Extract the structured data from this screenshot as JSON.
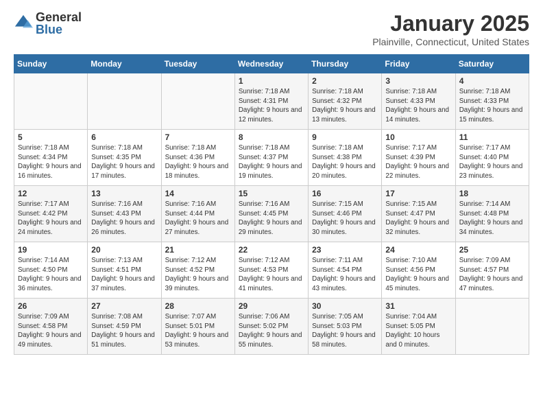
{
  "logo": {
    "line1": "General",
    "line2": "Blue"
  },
  "title": "January 2025",
  "subtitle": "Plainville, Connecticut, United States",
  "days_of_week": [
    "Sunday",
    "Monday",
    "Tuesday",
    "Wednesday",
    "Thursday",
    "Friday",
    "Saturday"
  ],
  "weeks": [
    [
      {
        "day": "",
        "info": ""
      },
      {
        "day": "",
        "info": ""
      },
      {
        "day": "",
        "info": ""
      },
      {
        "day": "1",
        "info": "Sunrise: 7:18 AM\nSunset: 4:31 PM\nDaylight: 9 hours\nand 12 minutes."
      },
      {
        "day": "2",
        "info": "Sunrise: 7:18 AM\nSunset: 4:32 PM\nDaylight: 9 hours\nand 13 minutes."
      },
      {
        "day": "3",
        "info": "Sunrise: 7:18 AM\nSunset: 4:33 PM\nDaylight: 9 hours\nand 14 minutes."
      },
      {
        "day": "4",
        "info": "Sunrise: 7:18 AM\nSunset: 4:33 PM\nDaylight: 9 hours\nand 15 minutes."
      }
    ],
    [
      {
        "day": "5",
        "info": "Sunrise: 7:18 AM\nSunset: 4:34 PM\nDaylight: 9 hours\nand 16 minutes."
      },
      {
        "day": "6",
        "info": "Sunrise: 7:18 AM\nSunset: 4:35 PM\nDaylight: 9 hours\nand 17 minutes."
      },
      {
        "day": "7",
        "info": "Sunrise: 7:18 AM\nSunset: 4:36 PM\nDaylight: 9 hours\nand 18 minutes."
      },
      {
        "day": "8",
        "info": "Sunrise: 7:18 AM\nSunset: 4:37 PM\nDaylight: 9 hours\nand 19 minutes."
      },
      {
        "day": "9",
        "info": "Sunrise: 7:18 AM\nSunset: 4:38 PM\nDaylight: 9 hours\nand 20 minutes."
      },
      {
        "day": "10",
        "info": "Sunrise: 7:17 AM\nSunset: 4:39 PM\nDaylight: 9 hours\nand 22 minutes."
      },
      {
        "day": "11",
        "info": "Sunrise: 7:17 AM\nSunset: 4:40 PM\nDaylight: 9 hours\nand 23 minutes."
      }
    ],
    [
      {
        "day": "12",
        "info": "Sunrise: 7:17 AM\nSunset: 4:42 PM\nDaylight: 9 hours\nand 24 minutes."
      },
      {
        "day": "13",
        "info": "Sunrise: 7:16 AM\nSunset: 4:43 PM\nDaylight: 9 hours\nand 26 minutes."
      },
      {
        "day": "14",
        "info": "Sunrise: 7:16 AM\nSunset: 4:44 PM\nDaylight: 9 hours\nand 27 minutes."
      },
      {
        "day": "15",
        "info": "Sunrise: 7:16 AM\nSunset: 4:45 PM\nDaylight: 9 hours\nand 29 minutes."
      },
      {
        "day": "16",
        "info": "Sunrise: 7:15 AM\nSunset: 4:46 PM\nDaylight: 9 hours\nand 30 minutes."
      },
      {
        "day": "17",
        "info": "Sunrise: 7:15 AM\nSunset: 4:47 PM\nDaylight: 9 hours\nand 32 minutes."
      },
      {
        "day": "18",
        "info": "Sunrise: 7:14 AM\nSunset: 4:48 PM\nDaylight: 9 hours\nand 34 minutes."
      }
    ],
    [
      {
        "day": "19",
        "info": "Sunrise: 7:14 AM\nSunset: 4:50 PM\nDaylight: 9 hours\nand 36 minutes."
      },
      {
        "day": "20",
        "info": "Sunrise: 7:13 AM\nSunset: 4:51 PM\nDaylight: 9 hours\nand 37 minutes."
      },
      {
        "day": "21",
        "info": "Sunrise: 7:12 AM\nSunset: 4:52 PM\nDaylight: 9 hours\nand 39 minutes."
      },
      {
        "day": "22",
        "info": "Sunrise: 7:12 AM\nSunset: 4:53 PM\nDaylight: 9 hours\nand 41 minutes."
      },
      {
        "day": "23",
        "info": "Sunrise: 7:11 AM\nSunset: 4:54 PM\nDaylight: 9 hours\nand 43 minutes."
      },
      {
        "day": "24",
        "info": "Sunrise: 7:10 AM\nSunset: 4:56 PM\nDaylight: 9 hours\nand 45 minutes."
      },
      {
        "day": "25",
        "info": "Sunrise: 7:09 AM\nSunset: 4:57 PM\nDaylight: 9 hours\nand 47 minutes."
      }
    ],
    [
      {
        "day": "26",
        "info": "Sunrise: 7:09 AM\nSunset: 4:58 PM\nDaylight: 9 hours\nand 49 minutes."
      },
      {
        "day": "27",
        "info": "Sunrise: 7:08 AM\nSunset: 4:59 PM\nDaylight: 9 hours\nand 51 minutes."
      },
      {
        "day": "28",
        "info": "Sunrise: 7:07 AM\nSunset: 5:01 PM\nDaylight: 9 hours\nand 53 minutes."
      },
      {
        "day": "29",
        "info": "Sunrise: 7:06 AM\nSunset: 5:02 PM\nDaylight: 9 hours\nand 55 minutes."
      },
      {
        "day": "30",
        "info": "Sunrise: 7:05 AM\nSunset: 5:03 PM\nDaylight: 9 hours\nand 58 minutes."
      },
      {
        "day": "31",
        "info": "Sunrise: 7:04 AM\nSunset: 5:05 PM\nDaylight: 10 hours\nand 0 minutes."
      },
      {
        "day": "",
        "info": ""
      }
    ]
  ]
}
